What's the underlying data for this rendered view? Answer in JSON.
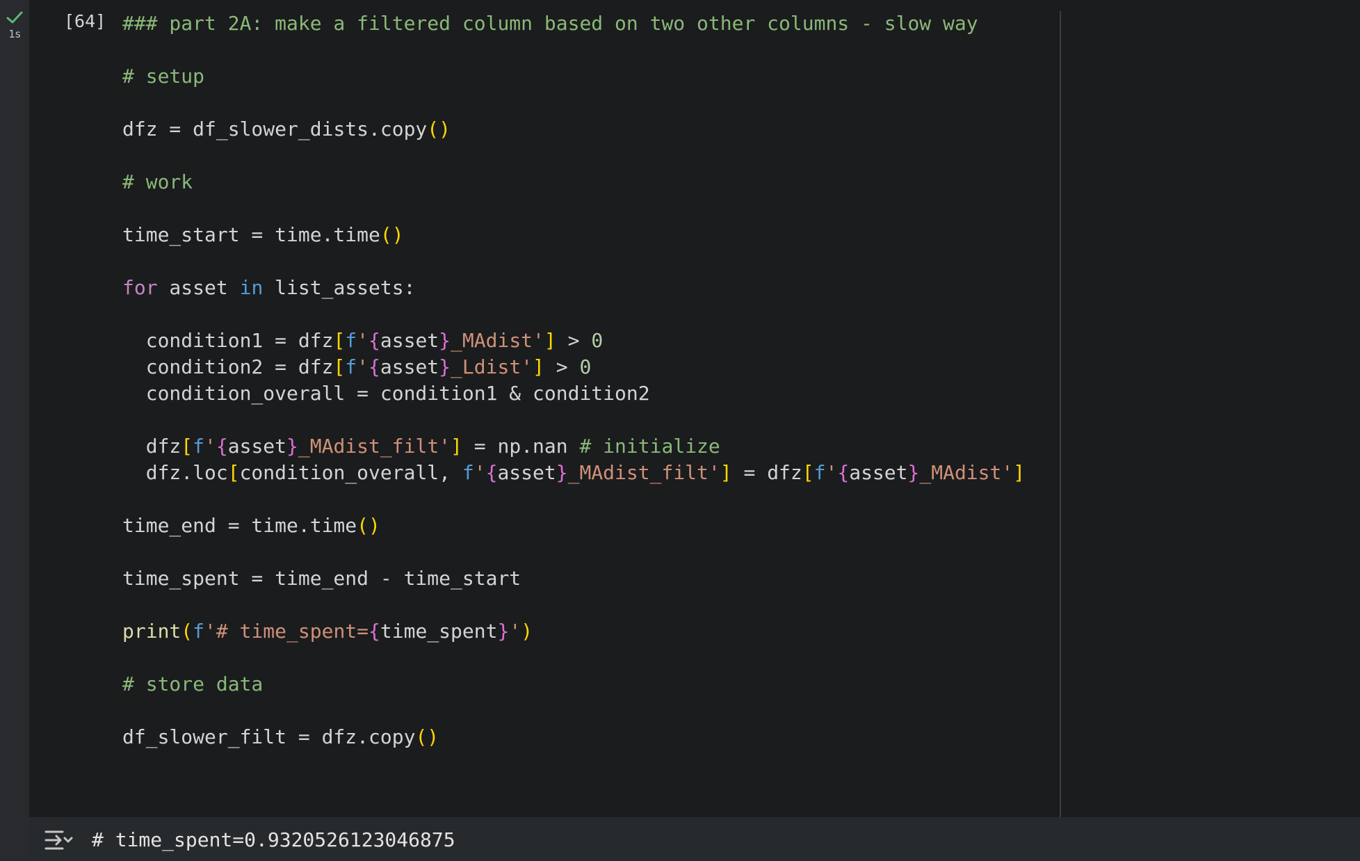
{
  "cell": {
    "status_icon": "check-icon",
    "exec_time": "1s",
    "exec_count": "[64]",
    "lines": [
      [
        {
          "t": "### part 2A: make a filtered column based on two other columns - slow way",
          "c": "cm"
        }
      ],
      [],
      [
        {
          "t": "# setup",
          "c": "cm"
        }
      ],
      [],
      [
        {
          "t": "dfz = df_slower_dists.copy",
          "c": "tx"
        },
        {
          "t": "()",
          "c": "br"
        }
      ],
      [],
      [
        {
          "t": "# work",
          "c": "cm"
        }
      ],
      [],
      [
        {
          "t": "time_start = time.time",
          "c": "tx"
        },
        {
          "t": "()",
          "c": "br"
        }
      ],
      [],
      [
        {
          "t": "for",
          "c": "kw"
        },
        {
          "t": " asset ",
          "c": "tx"
        },
        {
          "t": "in",
          "c": "in"
        },
        {
          "t": " list_assets:",
          "c": "tx"
        }
      ],
      [],
      [
        {
          "t": "  condition1 = dfz",
          "c": "tx"
        },
        {
          "t": "[",
          "c": "br"
        },
        {
          "t": "f",
          "c": "fp"
        },
        {
          "t": "'",
          "c": "st"
        },
        {
          "t": "{",
          "c": "br2"
        },
        {
          "t": "asset",
          "c": "tx"
        },
        {
          "t": "}",
          "c": "br2"
        },
        {
          "t": "_MAdist'",
          "c": "st"
        },
        {
          "t": "]",
          "c": "br"
        },
        {
          "t": " > ",
          "c": "tx"
        },
        {
          "t": "0",
          "c": "nm"
        }
      ],
      [
        {
          "t": "  condition2 = dfz",
          "c": "tx"
        },
        {
          "t": "[",
          "c": "br"
        },
        {
          "t": "f",
          "c": "fp"
        },
        {
          "t": "'",
          "c": "st"
        },
        {
          "t": "{",
          "c": "br2"
        },
        {
          "t": "asset",
          "c": "tx"
        },
        {
          "t": "}",
          "c": "br2"
        },
        {
          "t": "_Ldist'",
          "c": "st"
        },
        {
          "t": "]",
          "c": "br"
        },
        {
          "t": " > ",
          "c": "tx"
        },
        {
          "t": "0",
          "c": "nm"
        }
      ],
      [
        {
          "t": "  condition_overall = condition1 & condition2",
          "c": "tx"
        }
      ],
      [],
      [
        {
          "t": "  dfz",
          "c": "tx"
        },
        {
          "t": "[",
          "c": "br"
        },
        {
          "t": "f",
          "c": "fp"
        },
        {
          "t": "'",
          "c": "st"
        },
        {
          "t": "{",
          "c": "br2"
        },
        {
          "t": "asset",
          "c": "tx"
        },
        {
          "t": "}",
          "c": "br2"
        },
        {
          "t": "_MAdist_filt'",
          "c": "st"
        },
        {
          "t": "]",
          "c": "br"
        },
        {
          "t": " = np.nan ",
          "c": "tx"
        },
        {
          "t": "# initialize",
          "c": "cm"
        }
      ],
      [
        {
          "t": "  dfz.loc",
          "c": "tx"
        },
        {
          "t": "[",
          "c": "br"
        },
        {
          "t": "condition_overall, ",
          "c": "tx"
        },
        {
          "t": "f",
          "c": "fp"
        },
        {
          "t": "'",
          "c": "st"
        },
        {
          "t": "{",
          "c": "br2"
        },
        {
          "t": "asset",
          "c": "tx"
        },
        {
          "t": "}",
          "c": "br2"
        },
        {
          "t": "_MAdist_filt'",
          "c": "st"
        },
        {
          "t": "]",
          "c": "br"
        },
        {
          "t": " = dfz",
          "c": "tx"
        },
        {
          "t": "[",
          "c": "br"
        },
        {
          "t": "f",
          "c": "fp"
        },
        {
          "t": "'",
          "c": "st"
        },
        {
          "t": "{",
          "c": "br2"
        },
        {
          "t": "asset",
          "c": "tx"
        },
        {
          "t": "}",
          "c": "br2"
        },
        {
          "t": "_MAdist'",
          "c": "st"
        },
        {
          "t": "]",
          "c": "br"
        }
      ],
      [],
      [
        {
          "t": "time_end = time.time",
          "c": "tx"
        },
        {
          "t": "()",
          "c": "br"
        }
      ],
      [],
      [
        {
          "t": "time_spent = time_end - time_start",
          "c": "tx"
        }
      ],
      [],
      [
        {
          "t": "print",
          "c": "fn"
        },
        {
          "t": "(",
          "c": "br"
        },
        {
          "t": "f",
          "c": "fp"
        },
        {
          "t": "'# time_spent=",
          "c": "st"
        },
        {
          "t": "{",
          "c": "br2"
        },
        {
          "t": "time_spent",
          "c": "tx"
        },
        {
          "t": "}",
          "c": "br2"
        },
        {
          "t": "'",
          "c": "st"
        },
        {
          "t": ")",
          "c": "br"
        }
      ],
      [],
      [
        {
          "t": "# store data",
          "c": "cm"
        }
      ],
      [],
      [
        {
          "t": "df_slower_filt = dfz.copy",
          "c": "tx"
        },
        {
          "t": "()",
          "c": "br"
        }
      ]
    ],
    "colors": {
      "cm": "#8ab978",
      "tx": "#d4d4d4",
      "br": "#ffd700",
      "br2": "#da70d6",
      "kw": "#c586c0",
      "in": "#569cd6",
      "fp": "#569cd6",
      "st": "#ce9178",
      "nm": "#b5cea8",
      "fn": "#dcdcaa"
    }
  },
  "output": {
    "toggle_icon": "output-toggle-icon",
    "text": "# time_spent=0.9320526123046875"
  }
}
